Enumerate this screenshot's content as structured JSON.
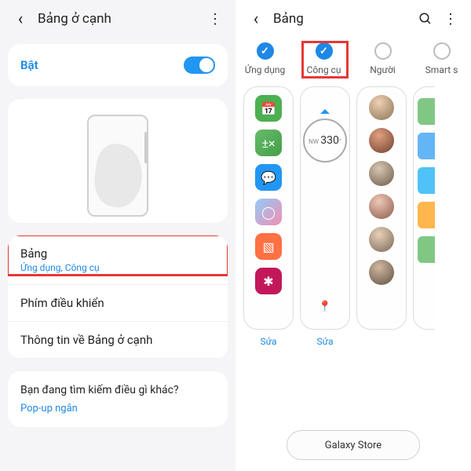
{
  "left": {
    "header_title": "Bảng ở cạnh",
    "toggle_label": "Bật",
    "menu": {
      "bang_title": "Bảng",
      "bang_subtitle": "Ứng dụng, Công cụ",
      "phim": "Phím điều khiển",
      "thongtin": "Thông tin về Bảng ở cạnh"
    },
    "footer": {
      "question": "Bạn đang tìm kiếm điều gì khác?",
      "popup": "Pop-up ngắn"
    }
  },
  "right": {
    "header_title": "Bảng",
    "tabs": {
      "ungdung": "Ứng dụng",
      "congcu": "Công cụ",
      "nguoi": "Người",
      "smart": "Smart s"
    },
    "compass_deg": "330",
    "compass_dir": "NW",
    "panel_edit": "Sửa",
    "store": "Galaxy Store"
  }
}
